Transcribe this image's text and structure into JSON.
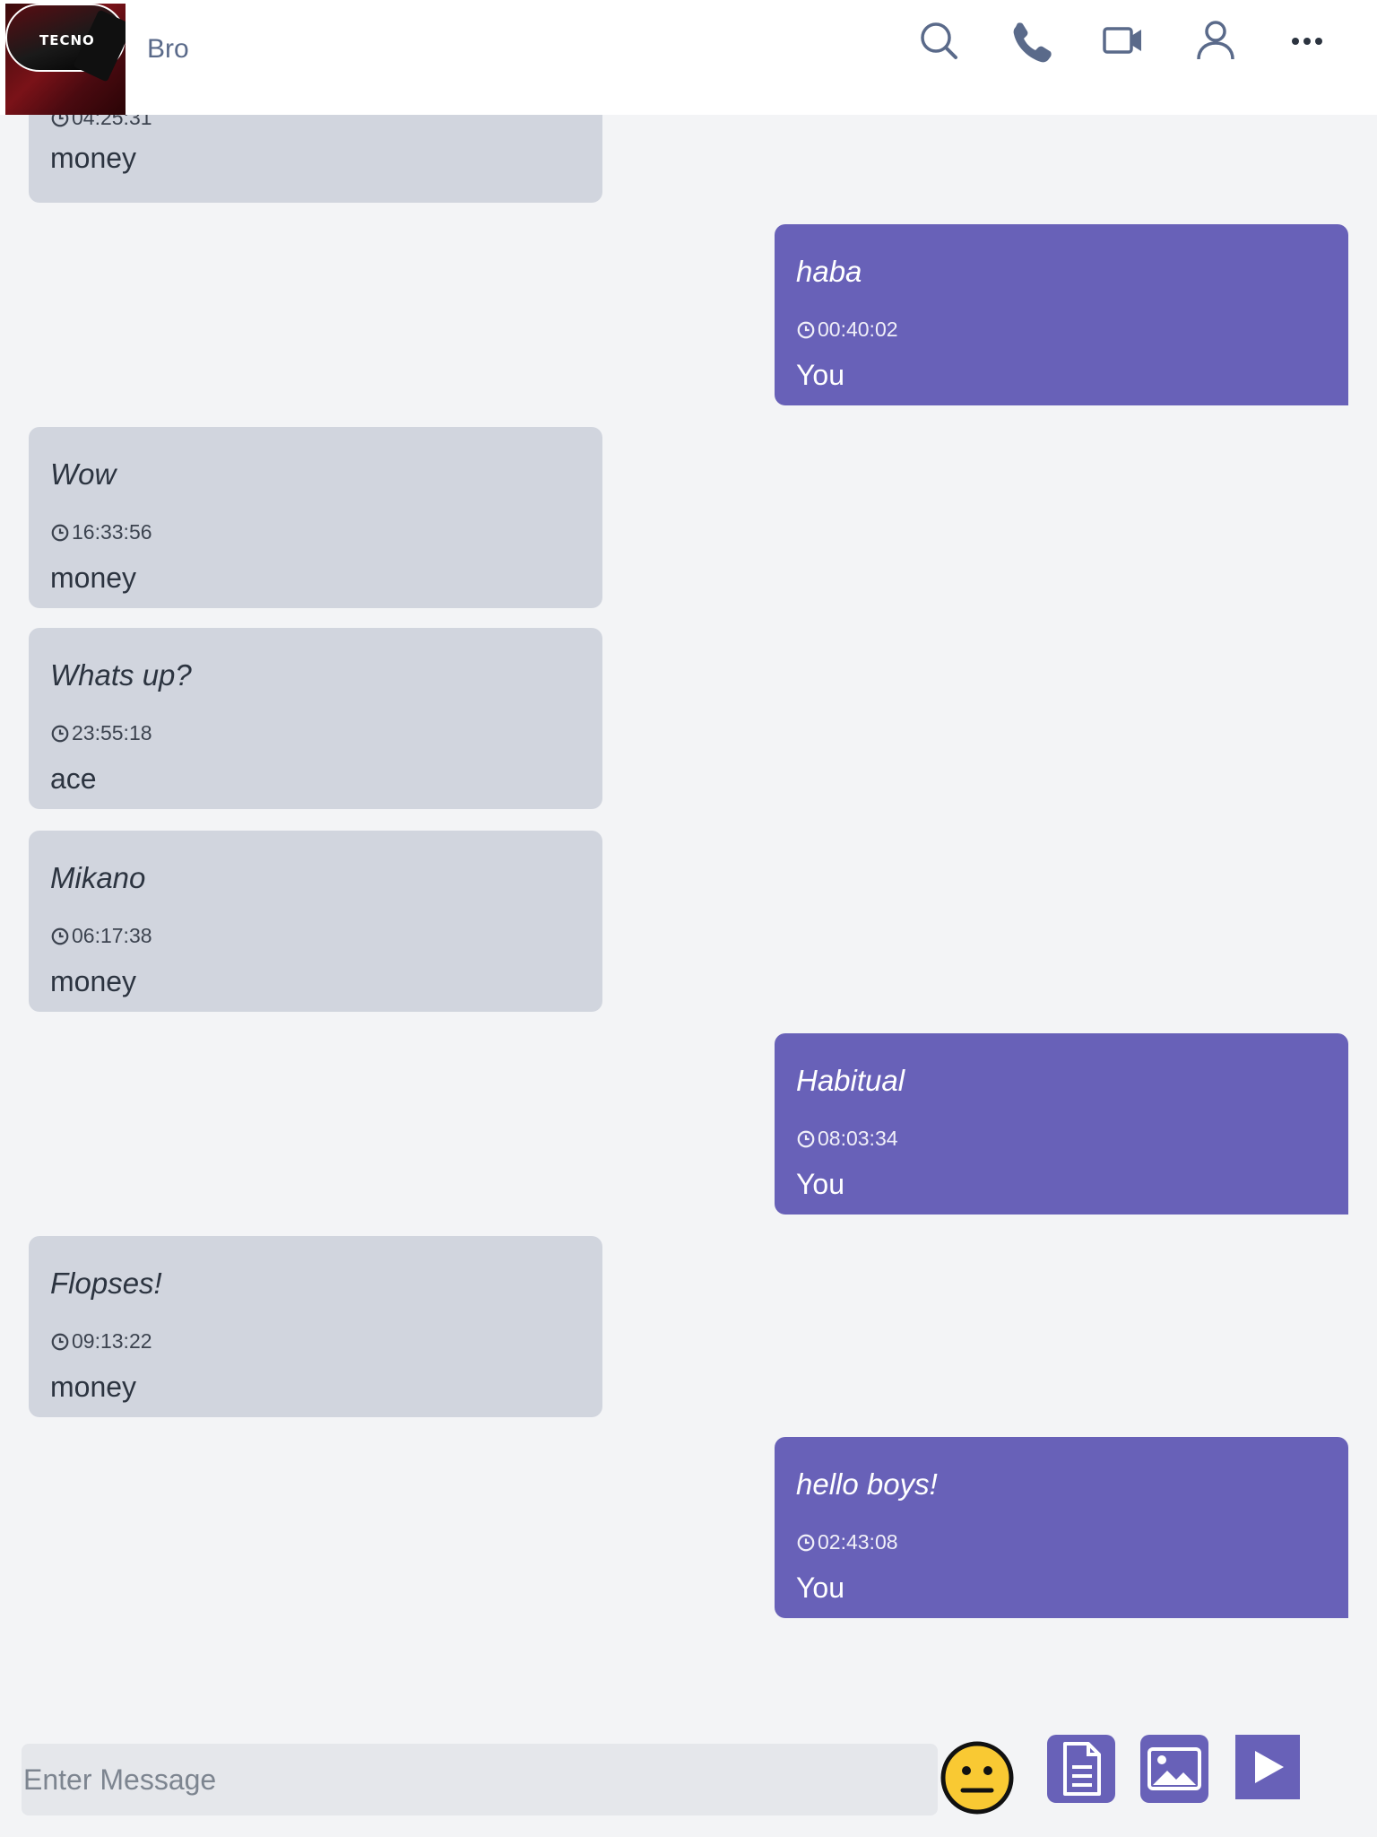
{
  "header": {
    "avatar_brand": "TECNO",
    "contact_name": "Bro",
    "icons": [
      "search-icon",
      "phone-icon",
      "video-icon",
      "user-icon",
      "more-icon"
    ]
  },
  "messages": [
    {
      "direction": "in",
      "text": "",
      "time": "04:25:31",
      "sender": "money"
    },
    {
      "direction": "out",
      "text": "haba",
      "time": "00:40:02",
      "sender": "You"
    },
    {
      "direction": "in",
      "text": "Wow",
      "time": "16:33:56",
      "sender": "money"
    },
    {
      "direction": "in",
      "text": "Whats up?",
      "time": "23:55:18",
      "sender": "ace"
    },
    {
      "direction": "in",
      "text": "Mikano",
      "time": "06:17:38",
      "sender": "money"
    },
    {
      "direction": "out",
      "text": "Habitual",
      "time": "08:03:34",
      "sender": "You"
    },
    {
      "direction": "in",
      "text": "Flopses!",
      "time": "09:13:22",
      "sender": "money"
    },
    {
      "direction": "out",
      "text": "hello boys!",
      "time": "02:43:08",
      "sender": "You"
    }
  ],
  "composer": {
    "placeholder": "Enter Message",
    "buttons": [
      "emoji-icon",
      "document-icon",
      "image-icon",
      "send-icon"
    ]
  },
  "colors": {
    "accent": "#6861b8",
    "incoming_bubble": "#d1d5de",
    "background": "#f3f4f6",
    "icon": "#5a6a8a"
  }
}
